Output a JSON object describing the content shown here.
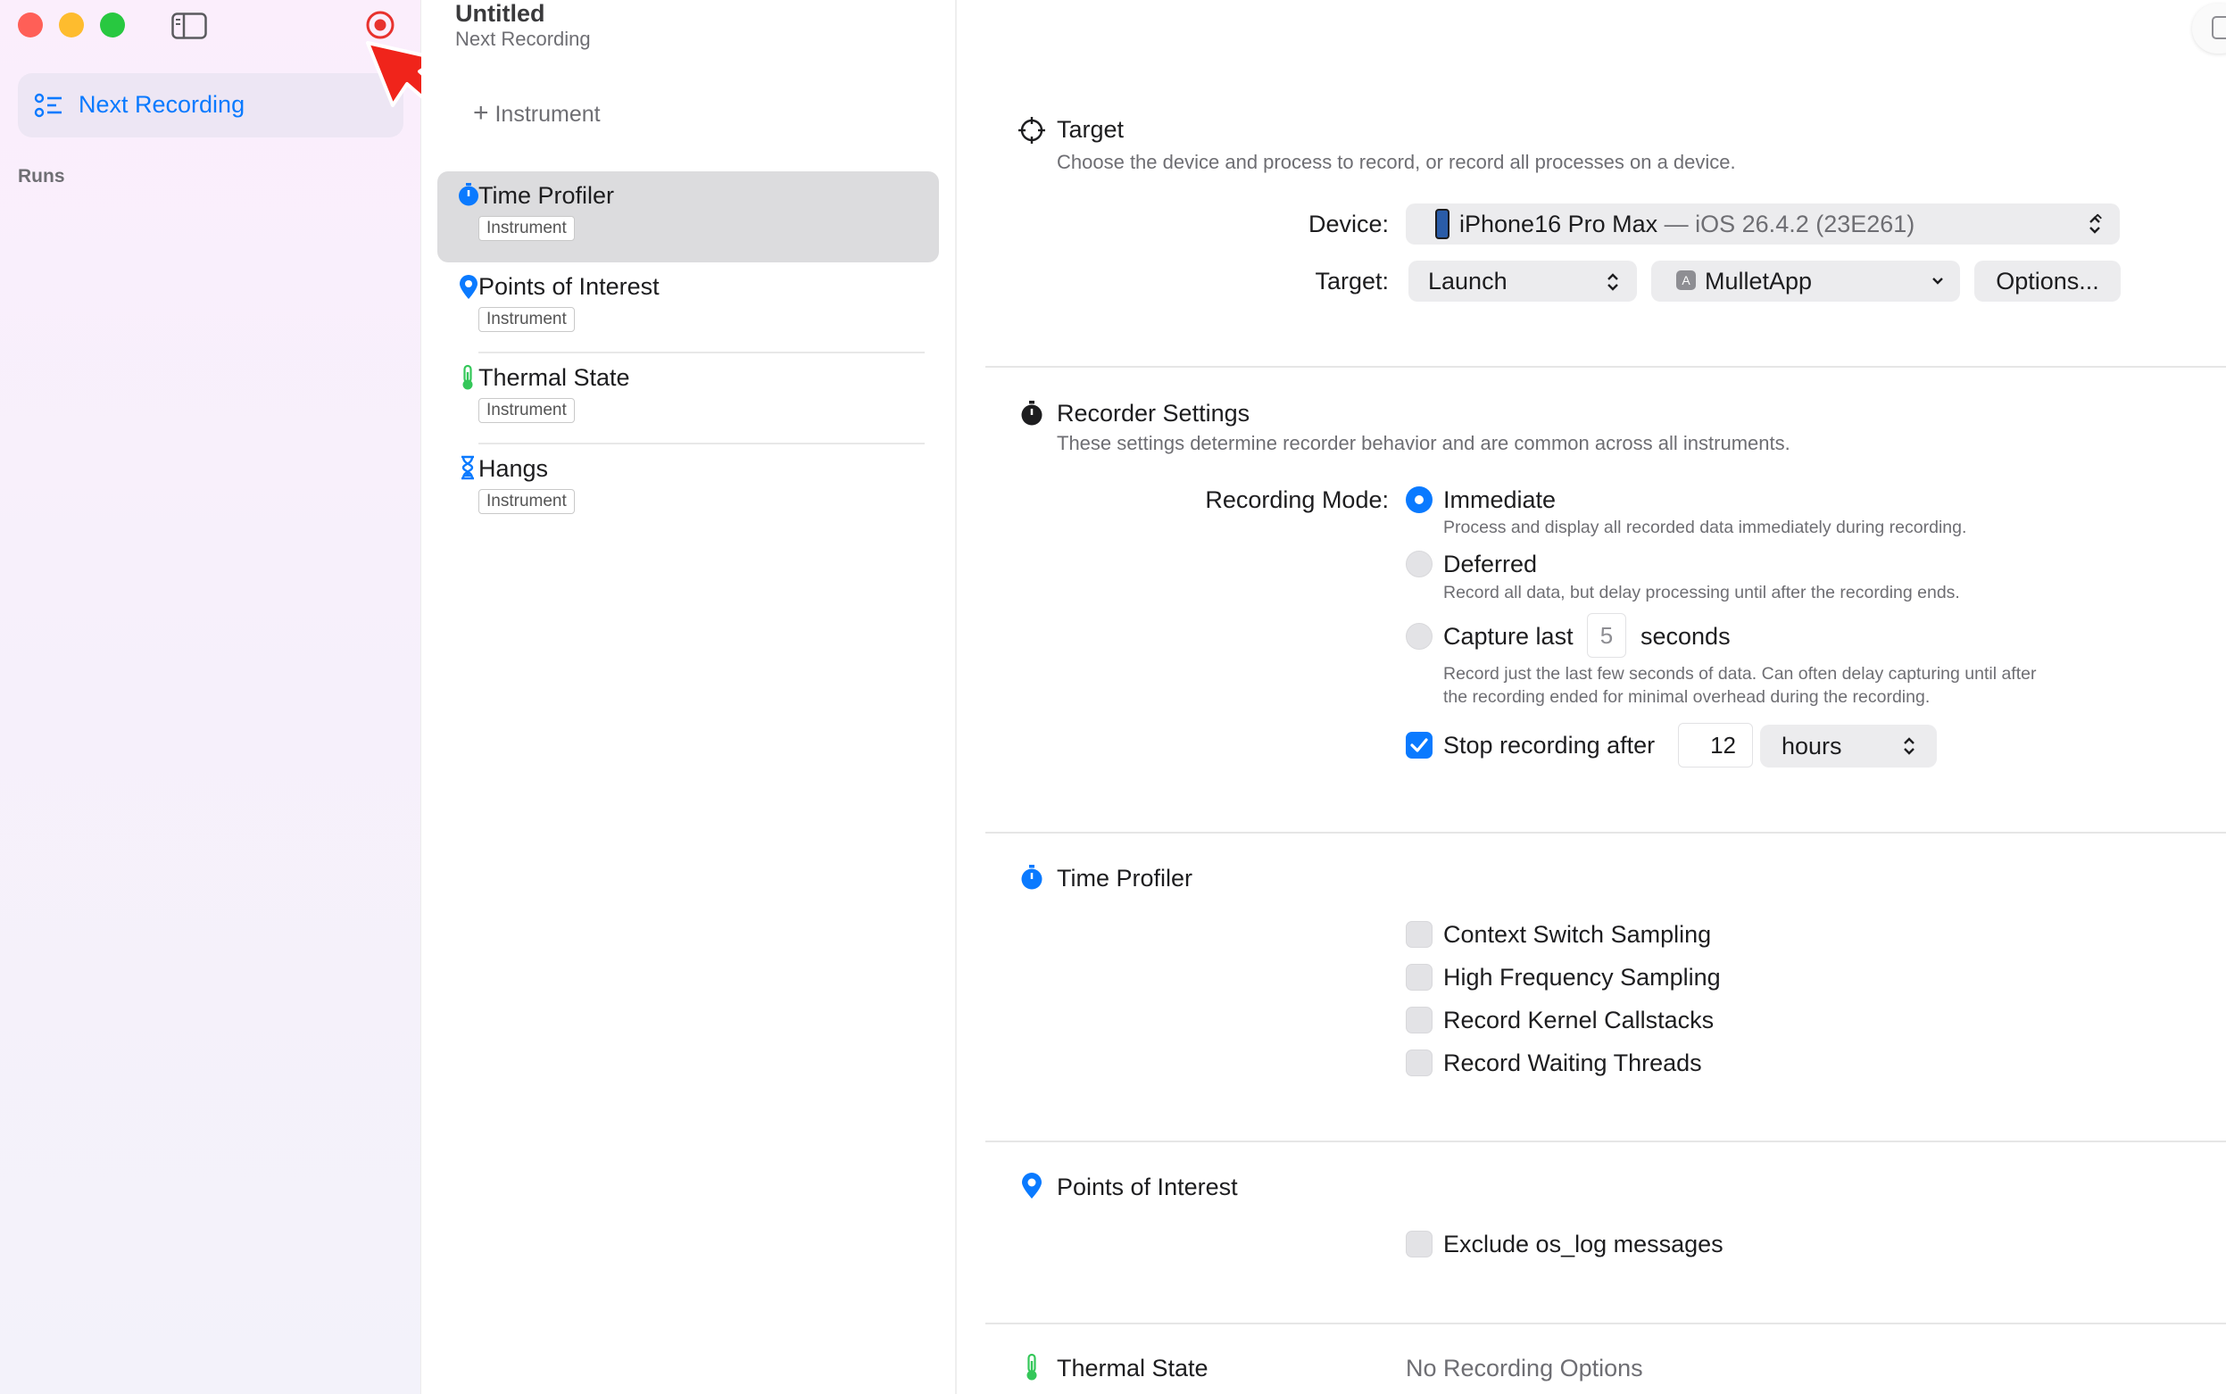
{
  "window": {
    "title": "Untitled",
    "subtitle": "Next Recording"
  },
  "sidebar": {
    "nav_item": "Next Recording",
    "section_header": "Runs"
  },
  "middle": {
    "add_instrument": "Instrument",
    "instruments": [
      {
        "name": "Time Profiler",
        "badge": "Instrument",
        "icon": "stopwatch-icon",
        "selected": true
      },
      {
        "name": "Points of Interest",
        "badge": "Instrument",
        "icon": "map-pin-icon",
        "selected": false
      },
      {
        "name": "Thermal State",
        "badge": "Instrument",
        "icon": "thermometer-icon",
        "selected": false
      },
      {
        "name": "Hangs",
        "badge": "Instrument",
        "icon": "hourglass-icon",
        "selected": false
      }
    ]
  },
  "target": {
    "title": "Target",
    "subtitle": "Choose the device and process to record, or record all processes on a device.",
    "device_label": "Device:",
    "device_name": "iPhone16 Pro Max",
    "device_os": " — iOS 26.4.2 (23E261)",
    "target_label": "Target:",
    "mode": "Launch",
    "app": "MulletApp",
    "options_button": "Options..."
  },
  "recorder": {
    "title": "Recorder Settings",
    "subtitle": "These settings determine recorder behavior and are common across all instruments.",
    "mode_label": "Recording Mode:",
    "immediate": "Immediate",
    "immediate_desc": "Process and display all recorded data immediately during recording.",
    "deferred": "Deferred",
    "deferred_desc": "Record all data, but delay processing until after the recording ends.",
    "capture_last": "Capture last",
    "capture_value": "5",
    "capture_unit": "seconds",
    "capture_desc_1": "Record just the last few seconds of data. Can often delay capturing until after",
    "capture_desc_2": "the recording ended for minimal overhead during the recording.",
    "stop_after": "Stop recording after",
    "stop_value": "12",
    "stop_unit": "hours",
    "selected_mode": "Immediate",
    "stop_checked": true
  },
  "time_profiler": {
    "title": "Time Profiler",
    "options": [
      "Context Switch Sampling",
      "High Frequency Sampling",
      "Record Kernel Callstacks",
      "Record Waiting Threads"
    ]
  },
  "poi": {
    "title": "Points of Interest",
    "option": "Exclude os_log messages"
  },
  "thermal": {
    "title": "Thermal State",
    "note": "No Recording Options"
  },
  "colors": {
    "accent": "#0a7aff",
    "record_red": "#e8322e",
    "close": "#ff5f57",
    "minimize": "#febc2e",
    "zoom": "#28c840"
  }
}
